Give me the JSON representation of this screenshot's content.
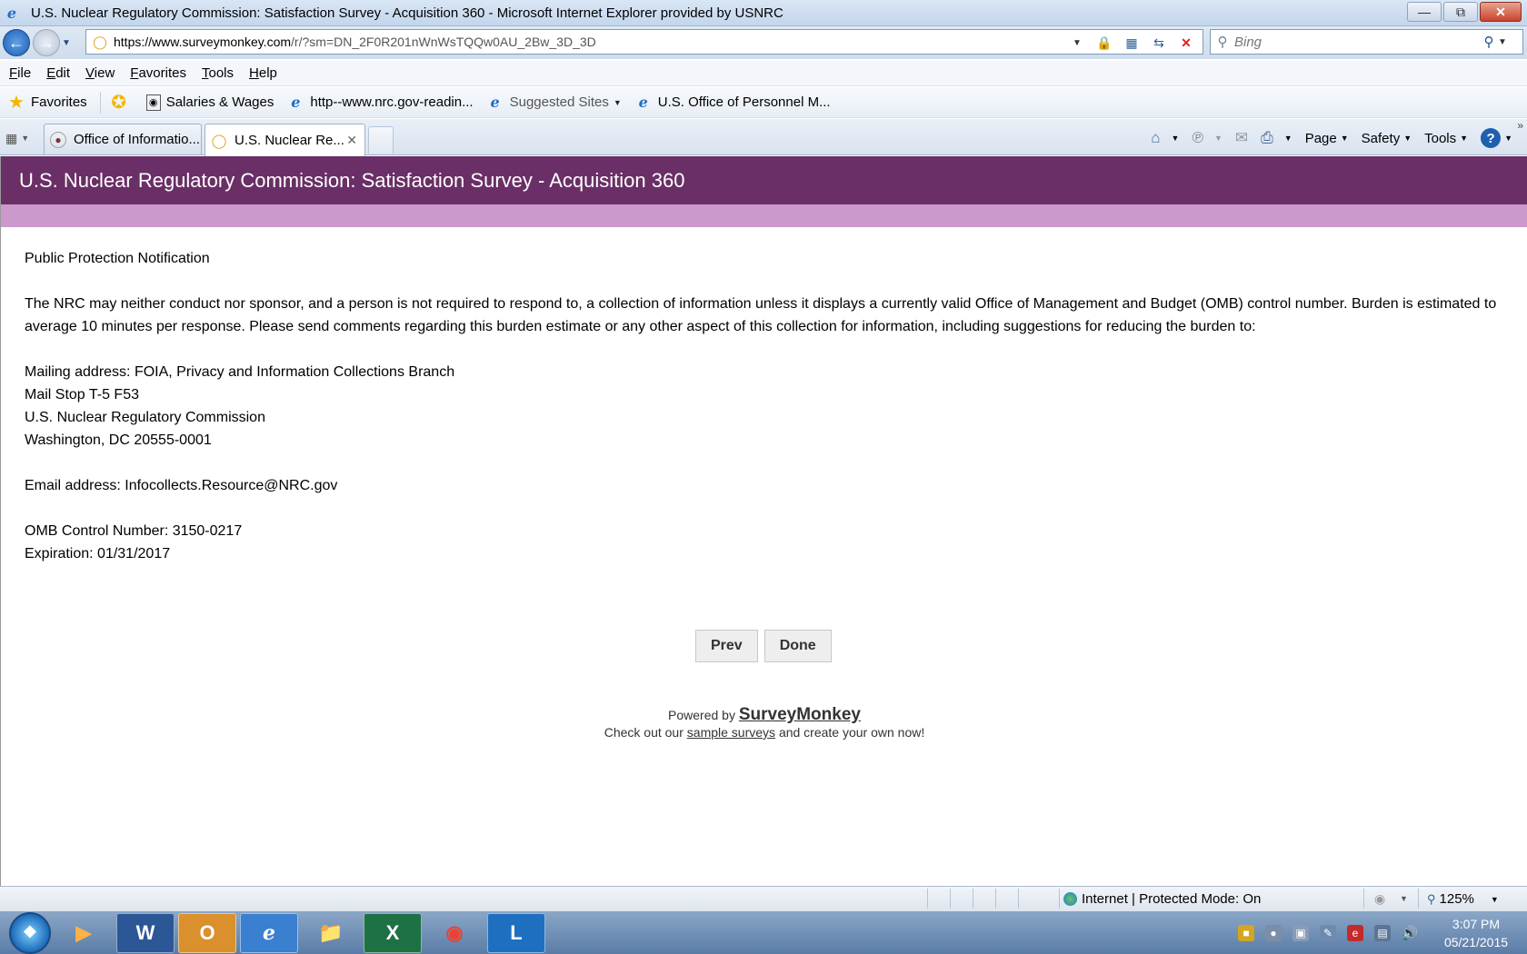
{
  "window": {
    "title": "U.S. Nuclear Regulatory Commission: Satisfaction Survey - Acquisition 360 - Microsoft Internet Explorer provided by USNRC",
    "minimize": "—",
    "restore": "⧉",
    "close": "✕"
  },
  "address": {
    "url_main": "https://www.surveymonkey.com",
    "url_rest": "/r/?sm=DN_2F0R201nWnWsTQQw0AU_2Bw_3D_3D"
  },
  "search": {
    "placeholder": "Bing"
  },
  "menu": [
    "File",
    "Edit",
    "View",
    "Favorites",
    "Tools",
    "Help"
  ],
  "favorites_bar": {
    "favorites_label": "Favorites",
    "items": [
      "Salaries & Wages",
      "http--www.nrc.gov-readin...",
      "Suggested Sites",
      "U.S. Office of Personnel M..."
    ]
  },
  "tabs": [
    {
      "label": "Office of Informatio..."
    },
    {
      "label": "U.S. Nuclear Re..."
    }
  ],
  "commands": {
    "page": "Page",
    "safety": "Safety",
    "tools": "Tools",
    "help": "?"
  },
  "survey": {
    "header_title": "U.S. Nuclear Regulatory Commission: Satisfaction Survey - Acquisition 360",
    "heading": "Public Protection Notification",
    "paragraph": "The NRC may neither conduct nor sponsor, and a person is not required to respond to, a collection of information unless it displays a currently valid Office of Management and Budget (OMB) control number. Burden is estimated to average 10 minutes per response. Please send comments regarding this burden estimate or any other aspect of this collection for information, including suggestions for reducing the burden to:",
    "address_lines": [
      "Mailing address: FOIA, Privacy and Information Collections Branch",
      "Mail Stop T-5 F53",
      "U.S. Nuclear Regulatory Commission",
      "Washington, DC 20555-0001"
    ],
    "email": "Email address: Infocollects.Resource@NRC.gov",
    "omb_number": "OMB Control Number: 3150-0217",
    "expiration": "Expiration: 01/31/2017",
    "prev_button": "Prev",
    "done_button": "Done",
    "footer": {
      "powered_by": "Powered by",
      "brand": "SurveyMonkey",
      "check_pre": "Check out our",
      "sample_link": "sample surveys",
      "check_post": "and create your own now!"
    }
  },
  "statusbar": {
    "zone": "Internet | Protected Mode: On",
    "zoom": "125%"
  },
  "taskbar": {
    "time": "3:07 PM",
    "date": "05/21/2015"
  },
  "colors": {
    "header_purple": "#6a2f66",
    "band_lilac": "#cc99cc"
  }
}
